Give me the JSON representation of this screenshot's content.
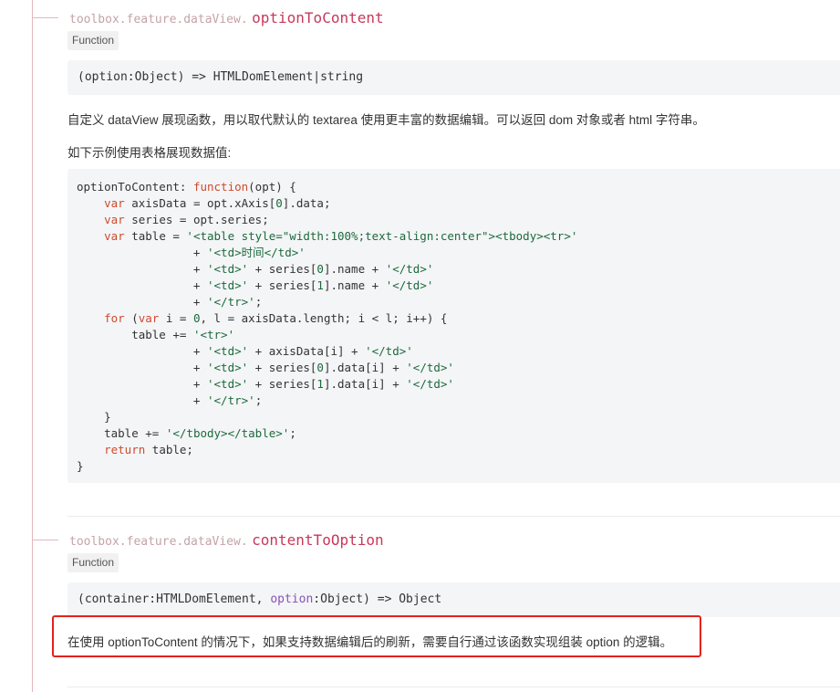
{
  "section1": {
    "prefix": "toolbox.feature.dataView.",
    "name": "optionToContent",
    "badge": "Function",
    "signature": "(option:Object) => HTMLDomElement|string",
    "description": "自定义 dataView 展现函数，用以取代默认的 textarea 使用更丰富的数据编辑。可以返回 dom 对象或者 html 字符串。",
    "example_intro": "如下示例使用表格展现数据值:"
  },
  "code_example": {
    "language": "javascript",
    "lines": [
      "optionToContent: function(opt) {",
      "    var axisData = opt.xAxis[0].data;",
      "    var series = opt.series;",
      "    var table = '<table style=\"width:100%;text-align:center\"><tbody><tr>'",
      "                 + '<td>时间</td>'",
      "                 + '<td>' + series[0].name + '</td>'",
      "                 + '<td>' + series[1].name + '</td>'",
      "                 + '</tr>';",
      "    for (var i = 0, l = axisData.length; i < l; i++) {",
      "        table += '<tr>'",
      "                 + '<td>' + axisData[i] + '</td>'",
      "                 + '<td>' + series[0].data[i] + '</td>'",
      "                 + '<td>' + series[1].data[i] + '</td>'",
      "                 + '</tr>';",
      "    }",
      "    table += '</tbody></table>';",
      "    return table;",
      "}"
    ]
  },
  "section2": {
    "prefix": "toolbox.feature.dataView.",
    "name": "contentToOption",
    "badge": "Function",
    "signature_a": "(container:HTMLDomElement, ",
    "signature_kw": "option",
    "signature_b": ":Object) => Object",
    "description": "在使用 optionToContent 的情况下，如果支持数据编辑后的刷新，需要自行通过该函数实现组装 option 的逻辑。"
  },
  "colors": {
    "title_name": "#c8385a",
    "title_prefix": "#c4a3a8",
    "tree_line": "#e4b8be",
    "highlight_border": "#e3221a",
    "code_bg": "#f4f5f7"
  }
}
